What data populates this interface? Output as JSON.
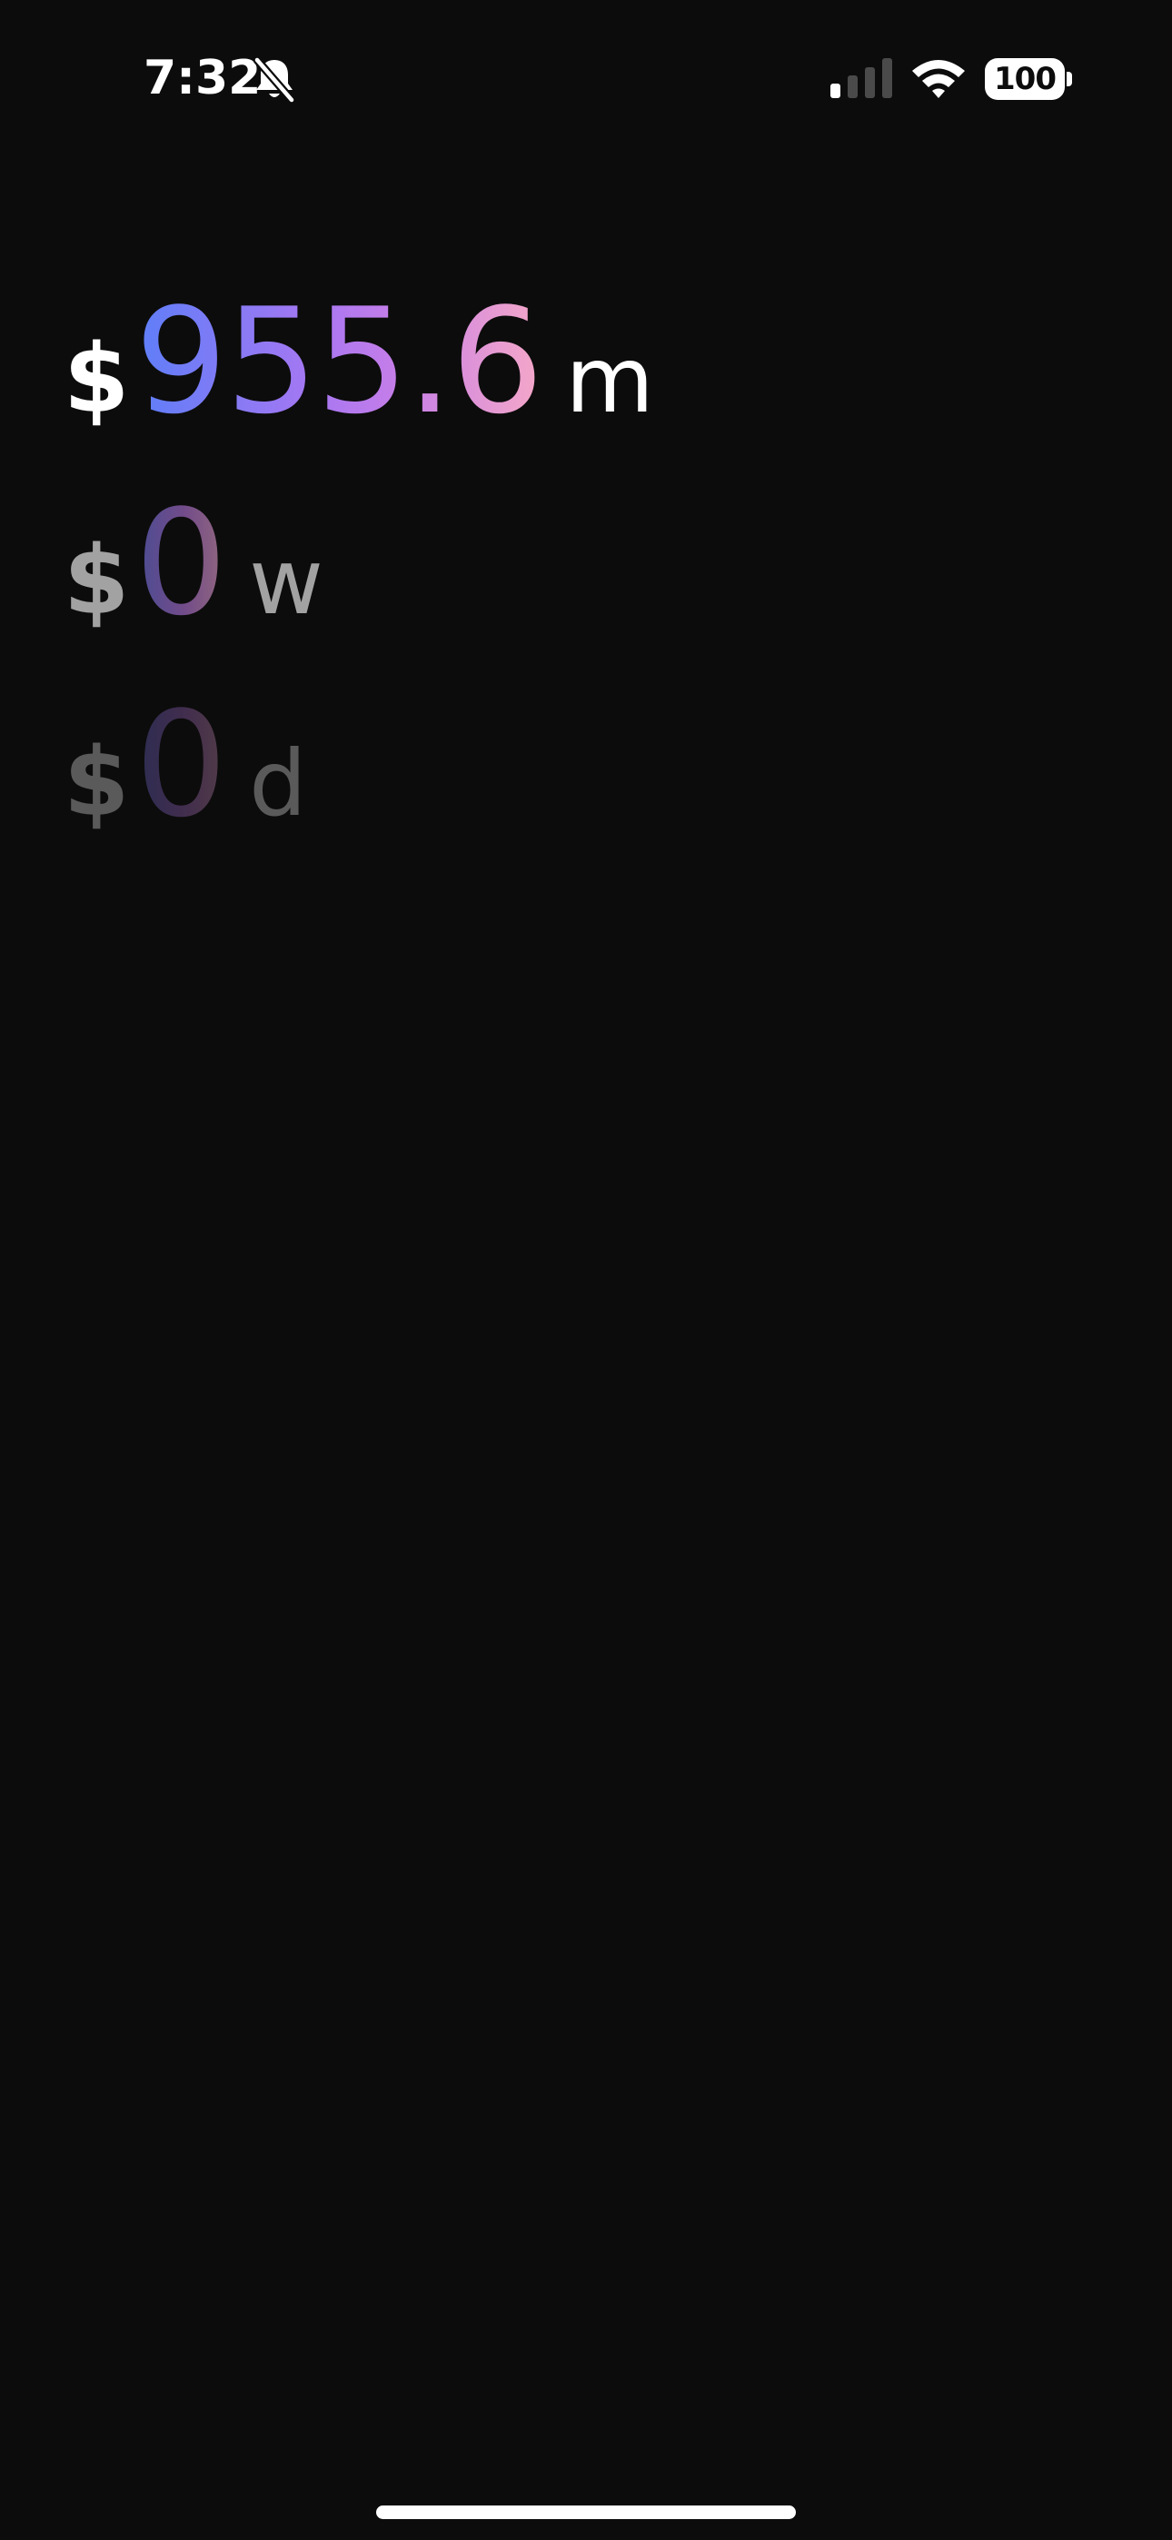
{
  "status_bar": {
    "time": "7:32",
    "silent_icon": "bell-slash-icon",
    "signal_icon": "cellular-signal-icon",
    "signal_bars_active": 1,
    "signal_bars_total": 4,
    "wifi_icon": "wifi-icon",
    "battery_level": "100"
  },
  "stats": [
    {
      "period": "month",
      "currency": "$",
      "amount": "955.6",
      "unit": "m"
    },
    {
      "period": "week",
      "currency": "$",
      "amount": "0",
      "unit": "w"
    },
    {
      "period": "day",
      "currency": "$",
      "amount": "0",
      "unit": "d"
    }
  ],
  "colors": {
    "background": "#0c0c0c",
    "gradient_start": "#5d7ef8",
    "gradient_mid": "#a877f2",
    "gradient_end": "#f5a8c8",
    "text": "#ffffff"
  }
}
